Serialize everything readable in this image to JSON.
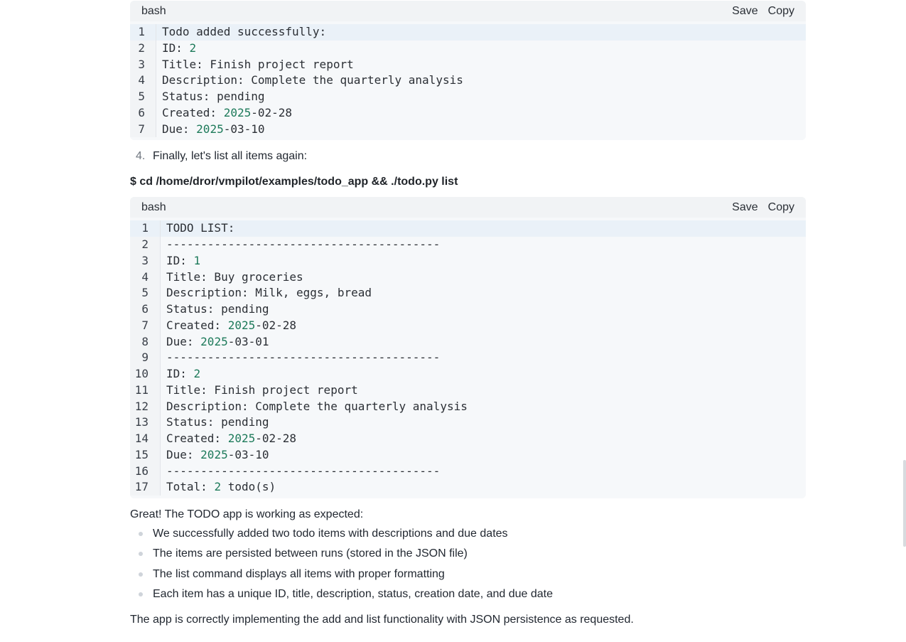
{
  "block1": {
    "lang": "bash",
    "save_label": "Save",
    "copy_label": "Copy",
    "lines": [
      [
        {
          "t": "Todo added successfully:"
        }
      ],
      [
        {
          "t": "ID: "
        },
        {
          "t": "2",
          "n": true
        }
      ],
      [
        {
          "t": "Title: Finish project report"
        }
      ],
      [
        {
          "t": "Description: Complete the quarterly analysis"
        }
      ],
      [
        {
          "t": "Status: pending"
        }
      ],
      [
        {
          "t": "Created: "
        },
        {
          "t": "2025",
          "n": true
        },
        {
          "t": "-02-28"
        }
      ],
      [
        {
          "t": "Due: "
        },
        {
          "t": "2025",
          "n": true
        },
        {
          "t": "-03-10"
        }
      ]
    ]
  },
  "step4": {
    "number": "4.",
    "text": "Finally, let's list all items again:"
  },
  "command": "$ cd /home/dror/vmpilot/examples/todo_app && ./todo.py list",
  "block2": {
    "lang": "bash",
    "save_label": "Save",
    "copy_label": "Copy",
    "lines": [
      [
        {
          "t": "TODO LIST:"
        }
      ],
      [
        {
          "t": "----------------------------------------"
        }
      ],
      [
        {
          "t": "ID: "
        },
        {
          "t": "1",
          "n": true
        }
      ],
      [
        {
          "t": "Title: Buy groceries"
        }
      ],
      [
        {
          "t": "Description: Milk, eggs, bread"
        }
      ],
      [
        {
          "t": "Status: pending"
        }
      ],
      [
        {
          "t": "Created: "
        },
        {
          "t": "2025",
          "n": true
        },
        {
          "t": "-02-28"
        }
      ],
      [
        {
          "t": "Due: "
        },
        {
          "t": "2025",
          "n": true
        },
        {
          "t": "-03-01"
        }
      ],
      [
        {
          "t": "----------------------------------------"
        }
      ],
      [
        {
          "t": "ID: "
        },
        {
          "t": "2",
          "n": true
        }
      ],
      [
        {
          "t": "Title: Finish project report"
        }
      ],
      [
        {
          "t": "Description: Complete the quarterly analysis"
        }
      ],
      [
        {
          "t": "Status: pending"
        }
      ],
      [
        {
          "t": "Created: "
        },
        {
          "t": "2025",
          "n": true
        },
        {
          "t": "-02-28"
        }
      ],
      [
        {
          "t": "Due: "
        },
        {
          "t": "2025",
          "n": true
        },
        {
          "t": "-03-10"
        }
      ],
      [
        {
          "t": "----------------------------------------"
        }
      ],
      [
        {
          "t": "Total: "
        },
        {
          "t": "2",
          "n": true
        },
        {
          "t": " todo(s)"
        }
      ]
    ]
  },
  "summary_intro": "Great! The TODO app is working as expected:",
  "bullets": [
    "We successfully added two todo items with descriptions and due dates",
    "The items are persisted between runs (stored in the JSON file)",
    "The list command displays all items with proper formatting",
    "Each item has a unique ID, title, description, status, creation date, and due date"
  ],
  "conclusion": "The app is correctly implementing the add and list functionality with JSON persistence as requested."
}
